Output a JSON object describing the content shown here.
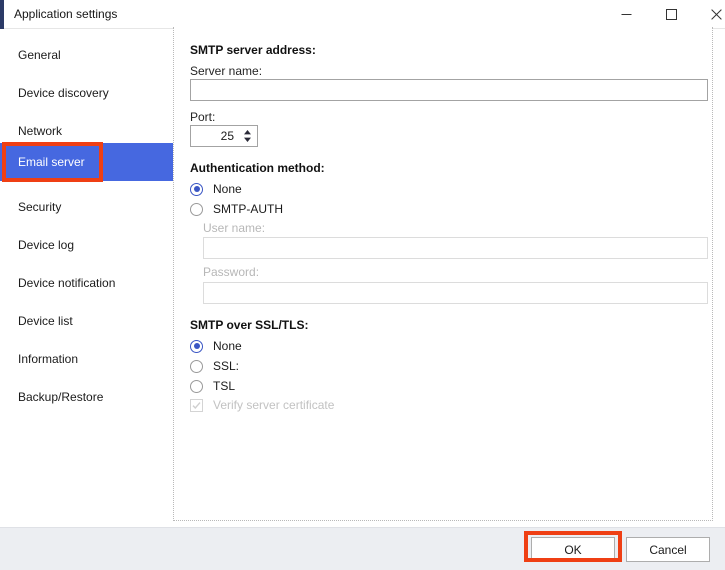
{
  "window": {
    "title": "Application settings",
    "controls": {
      "minimize": "minimize-icon",
      "maximize": "maximize-icon",
      "close": "close-icon"
    },
    "accent_color": "#2b3a67"
  },
  "sidebar": {
    "selected_index": 3,
    "selected_color": "#4668e0",
    "items": [
      {
        "label": "General"
      },
      {
        "label": "Device discovery"
      },
      {
        "label": "Network"
      },
      {
        "label": "Email server"
      },
      {
        "label": "Security"
      },
      {
        "label": "Device log"
      },
      {
        "label": "Device notification"
      },
      {
        "label": "Device list"
      },
      {
        "label": "Information"
      },
      {
        "label": "Backup/Restore"
      }
    ]
  },
  "main": {
    "smtp_address": {
      "heading": "SMTP server address:",
      "server_name_label": "Server name:",
      "server_name_value": "",
      "server_name_placeholder": "",
      "port_label": "Port:",
      "port_value": "25",
      "port_spinner": "spinner-up-down-icon"
    },
    "authentication": {
      "heading": "Authentication method:",
      "options": [
        {
          "label": "None",
          "checked": true
        },
        {
          "label": "SMTP-AUTH",
          "checked": false
        }
      ],
      "user_name_label": "User name:",
      "user_name_value": "",
      "user_name_disabled": true,
      "password_label": "Password:",
      "password_value": "",
      "password_disabled": true
    },
    "ssl_tls": {
      "heading": "SMTP over SSL/TLS:",
      "options": [
        {
          "label": "None",
          "checked": true
        },
        {
          "label": "SSL:",
          "checked": false
        },
        {
          "label": "TSL",
          "checked": false
        }
      ],
      "verify_label": "Verify server certificate",
      "verify_checked": true,
      "verify_disabled": true
    }
  },
  "footer": {
    "ok_label": "OK",
    "cancel_label": "Cancel"
  },
  "annotations": {
    "color": "#ef3f14",
    "targets": [
      "Email server",
      "OK"
    ]
  }
}
